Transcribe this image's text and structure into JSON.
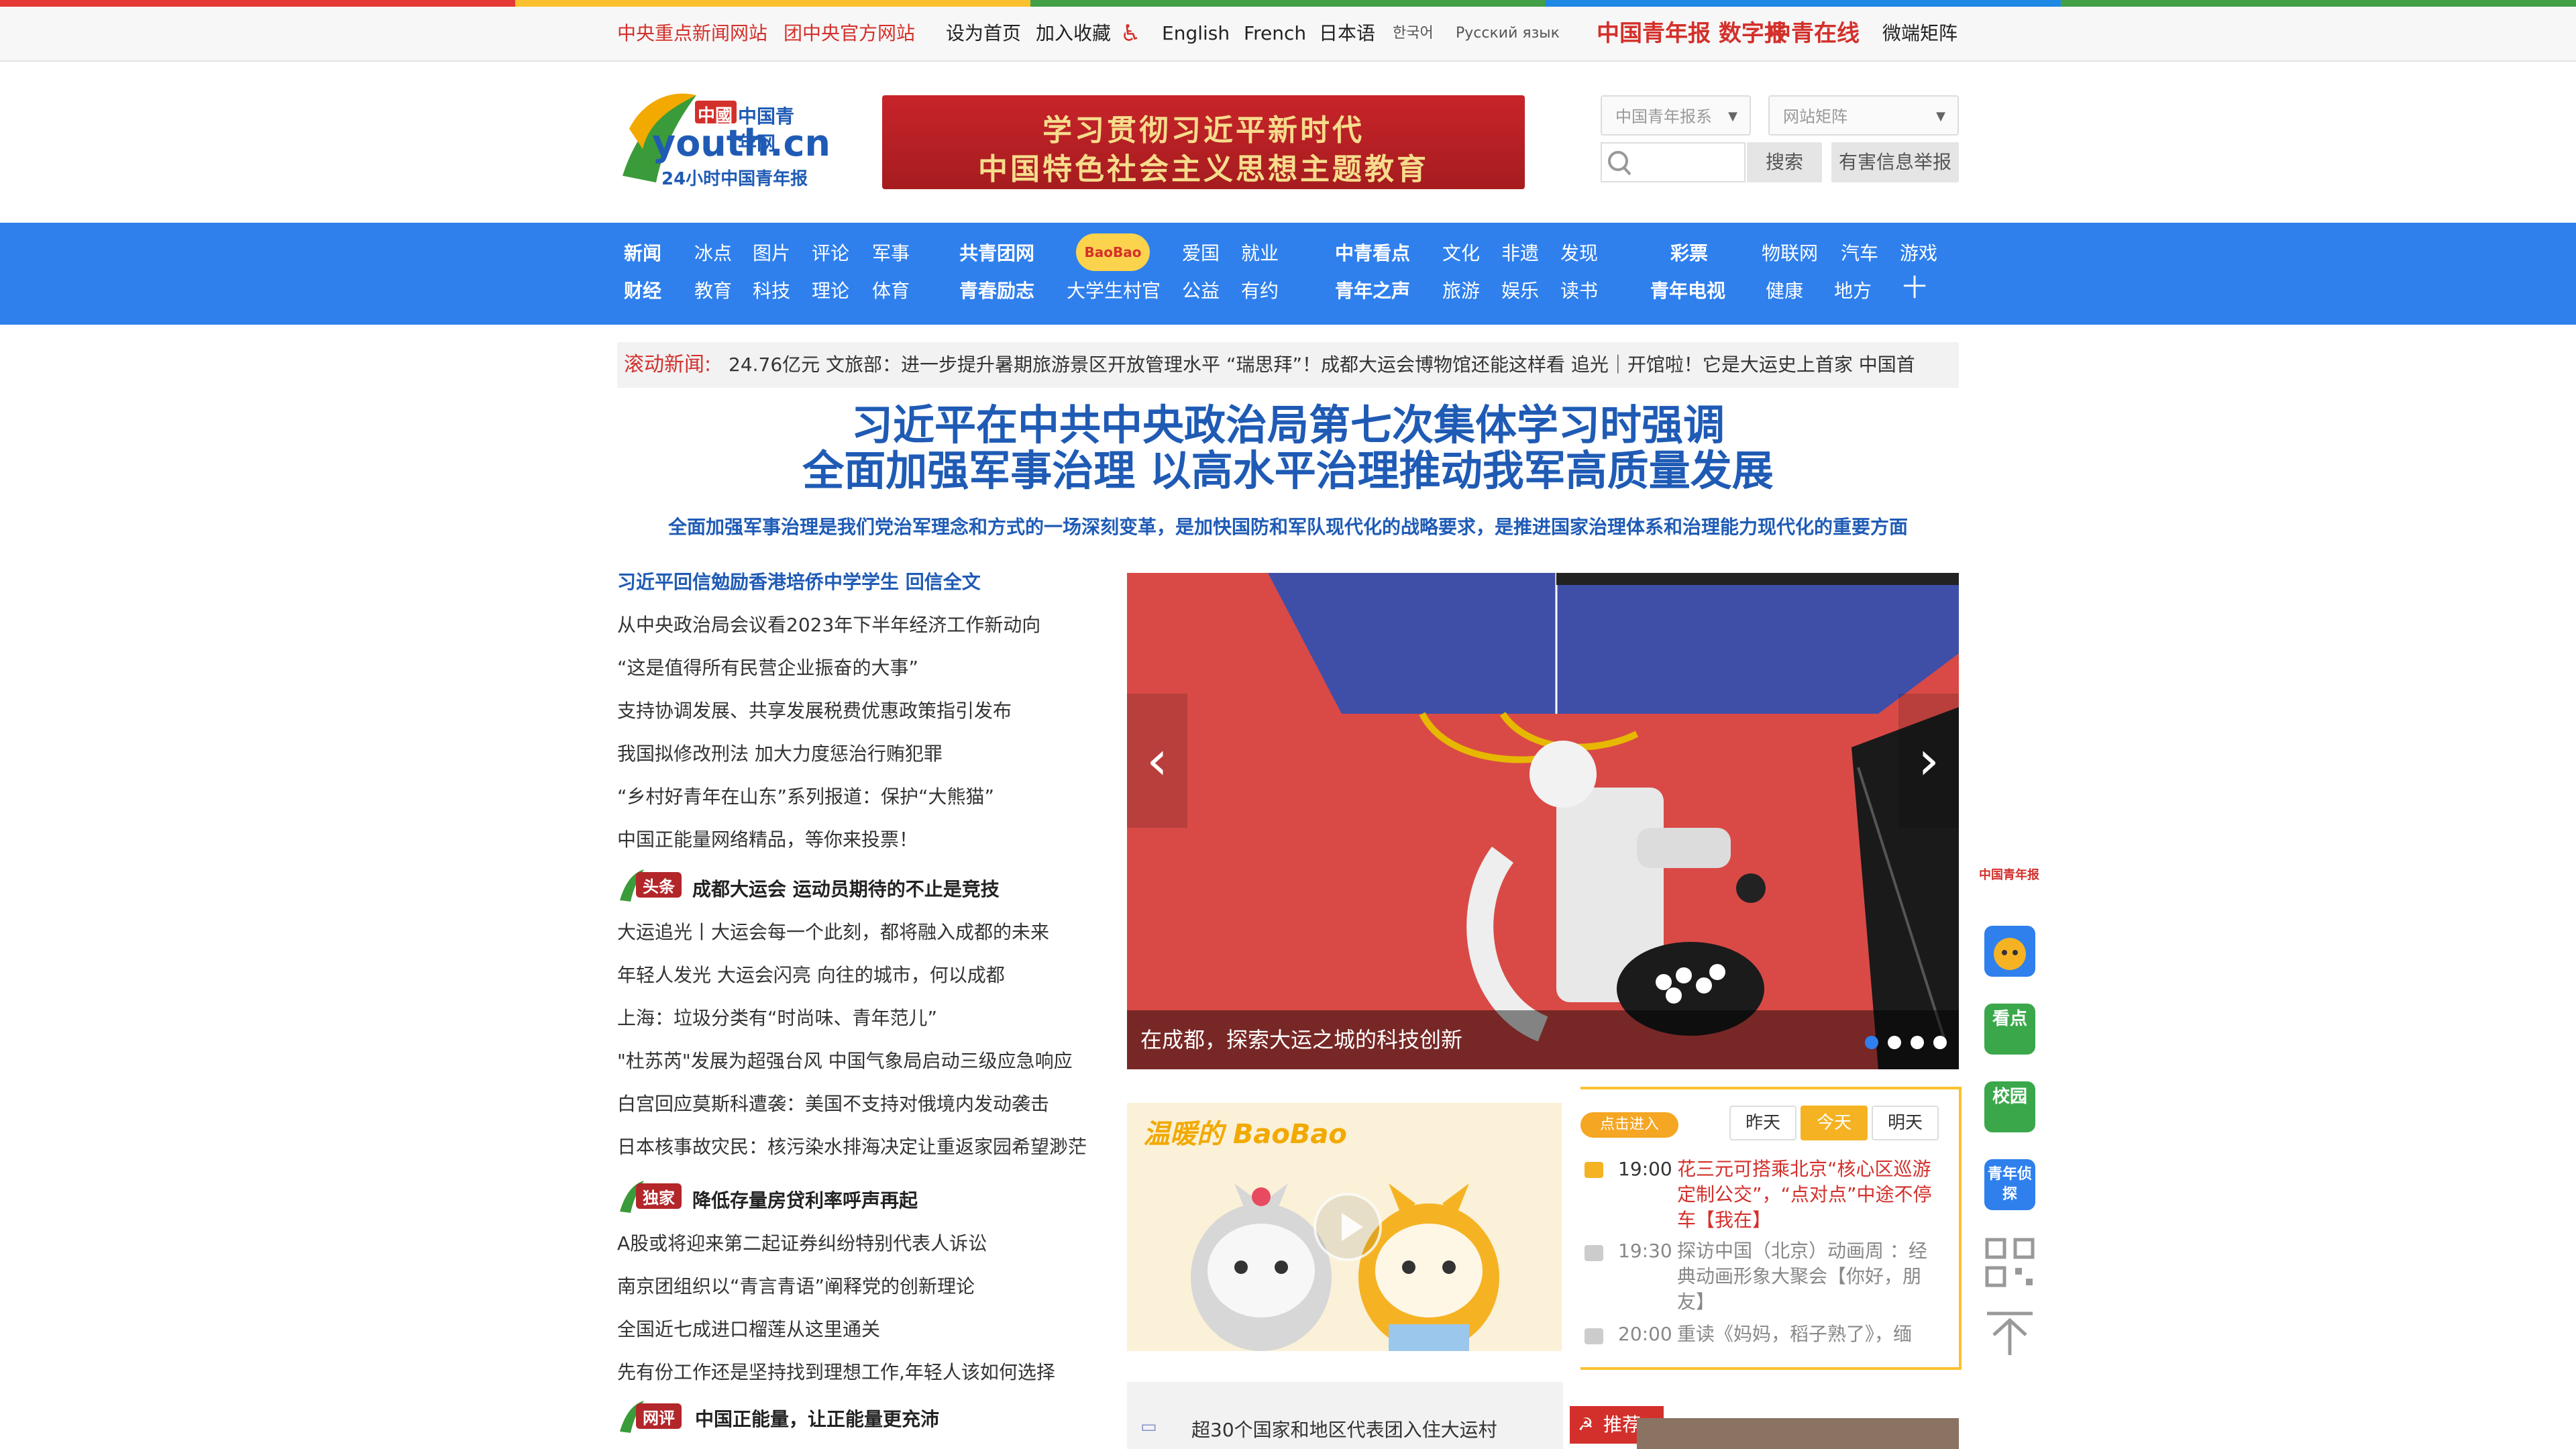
{
  "topbar": {
    "links": [
      "中央重点新闻网站",
      "团中央官方网站",
      "设为首页",
      "加入收藏",
      "English",
      "French",
      "日本语",
      "한국어",
      "Русский язык",
      "微端矩阵"
    ],
    "logos": [
      "中国青年报 数字报",
      "中青在线"
    ]
  },
  "header": {
    "logo_main": "youth.cn",
    "logo_cn": "中国青年网",
    "logo_sub": "24小时中国青年报",
    "banner_line1": "学习贯彻习近平新时代",
    "banner_line2": "中国特色社会主义思想主题教育",
    "select1": "中国青年报系",
    "select2": "网站矩阵",
    "search_button": "搜索",
    "report_button": "有害信息举报"
  },
  "nav": {
    "col1": [
      "新闻",
      "财经"
    ],
    "col1_sub": [
      "冰点",
      "图片",
      "评论",
      "军事",
      "教育",
      "科技",
      "理论",
      "体育"
    ],
    "col2": [
      "共青团网",
      "青春励志"
    ],
    "col2_sub": [
      "爱国",
      "就业",
      "大学生村官",
      "公益",
      "有约"
    ],
    "col3": [
      "中青看点",
      "青年之声"
    ],
    "col3_sub": [
      "文化",
      "非遗",
      "发现",
      "旅游",
      "娱乐",
      "读书"
    ],
    "col4": [
      "彩票",
      "青年电视"
    ],
    "col4_sub": [
      "物联网",
      "汽车",
      "游戏",
      "健康",
      "地方",
      "十"
    ]
  },
  "ticker": {
    "label": "滚动新闻:",
    "text": "24.76亿元   文旅部：进一步提升暑期旅游景区开放管理水平   “瑞思拜”！成都大运会博物馆还能这样看   追光｜开馆啦！它是大运史上首家   中国首"
  },
  "headline": {
    "line1": "习近平在中共中央政治局第七次集体学习时强调",
    "line2": "全面加强军事治理 以高水平治理推动我军高质量发展",
    "sub": "全面加强军事治理是我们党治军理念和方式的一场深刻变革，是加快国防和军队现代化的战略要求，是推进国家治理体系和治理能力现代化的重要方面"
  },
  "left_news": {
    "group1": [
      "习近平回信勉励香港培侨中学学生 回信全文",
      "从中央政治局会议看2023年下半年经济工作新动向",
      "“这是值得所有民营企业振奋的大事”",
      "支持协调发展、共享发展税费优惠政策指引发布",
      "我国拟修改刑法 加大力度惩治行贿犯罪",
      "“乡村好青年在山东”系列报道：保护“大熊猫”",
      "中国正能量网络精品，等你来投票！"
    ],
    "tag1": "头条",
    "tag1_title": "成都大运会 运动员期待的不止是竞技",
    "group2": [
      "大运追光丨大运会每一个此刻，都将融入成都的未来",
      "年轻人发光 大运会闪亮 向往的城市，何以成都",
      "上海：垃圾分类有“时尚味、青年范儿”",
      "\"杜苏芮\"发展为超强台风 中国气象局启动三级应急响应",
      "白宫回应莫斯科遭袭：美国不支持对俄境内发动袭击",
      "日本核事故灾民：核污染水排海决定让重返家园希望渺茫"
    ],
    "tag2": "独家",
    "tag2_title": "降低存量房贷利率呼声再起",
    "group3": [
      "A股或将迎来第二起证券纠纷特别代表人诉讼",
      "南京团组织以“青言青语”阐释党的创新理论",
      "全国近七成进口榴莲从这里通关",
      "先有份工作还是坚持找到理想工作,年轻人该如何选择"
    ],
    "tag3": "网评",
    "tag3_title": "中国正能量，让正能量更充沛"
  },
  "slider": {
    "caption": "在成都，探索大运之城的科技创新",
    "active_dot": 0,
    "dot_count": 4
  },
  "video": {
    "brand": "温暖的 BaoBao"
  },
  "schedule": {
    "entry_label": "点击进入",
    "days": [
      "昨天",
      "今天",
      "明天"
    ],
    "active_day": "今天",
    "items": [
      {
        "time": "19:00",
        "title": "花三元可搭乘北京“核心区巡游定制公交”，“点对点”中途不停车【我在】",
        "active": true
      },
      {
        "time": "19:30",
        "title": "探访中国（北京）动画周 ：经典动画形象大聚会【你好，朋友】",
        "active": false
      },
      {
        "time": "20:00",
        "title": "重读《妈妈，稻子熟了》，缅",
        "active": false
      }
    ]
  },
  "bottom": {
    "news": "超30个国家和地区代表团入住大运村",
    "recommend": "推荐"
  },
  "sidebar": {
    "items": [
      "中国青年报",
      "宝宝",
      "看点",
      "校园",
      "青年侦探",
      "二维码",
      "返回顶部"
    ]
  },
  "colors": {
    "nav_blue": "#2f80ed",
    "headline_blue": "#1f5bb5",
    "red": "#d3302b",
    "accent_yellow": "#f5b324"
  }
}
